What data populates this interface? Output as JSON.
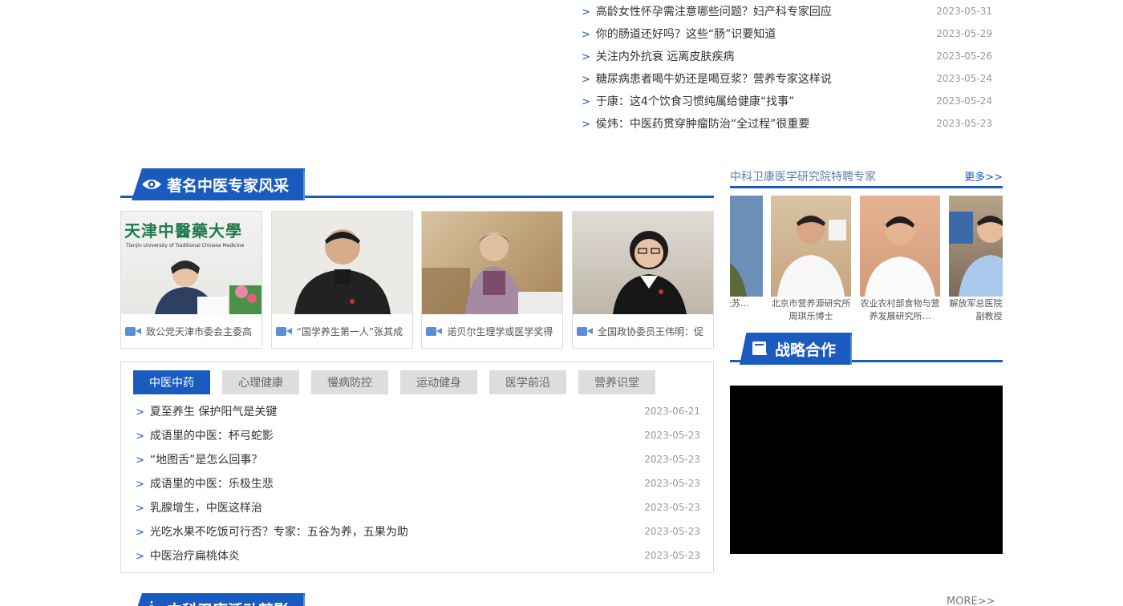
{
  "top_news": [
    {
      "title": "高龄女性怀孕需注意哪些问题？妇产科专家回应",
      "date": "2023-05-31"
    },
    {
      "title": "你的肠道还好吗？这些“肠”识要知道",
      "date": "2023-05-29"
    },
    {
      "title": "关注内外抗衰 远离皮肤疾病",
      "date": "2023-05-26"
    },
    {
      "title": "糖尿病患者喝牛奶还是喝豆浆？营养专家这样说",
      "date": "2023-05-24"
    },
    {
      "title": "于康：这4个饮食习惯纯属给健康“找事”",
      "date": "2023-05-24"
    },
    {
      "title": "侯炜：中医药贯穿肿瘤防治“全过程”很重要",
      "date": "2023-05-23"
    }
  ],
  "experts_section": {
    "title": "著名中医专家风采"
  },
  "experts": [
    {
      "caption": "致公党天津市委会主委高"
    },
    {
      "caption": "“国学养生第一人”张其成"
    },
    {
      "caption": "诺贝尔生理学或医学奖得"
    },
    {
      "caption": "全国政协委员王伟明：促"
    }
  ],
  "tju_sign": {
    "cn": "天津中醫藥大學",
    "en": "Tianjin University of Traditional Chinese Medicine"
  },
  "tabs": [
    "中医中药",
    "心理健康",
    "慢病防控",
    "运动健身",
    "医学前沿",
    "营养识堂"
  ],
  "tab_news": [
    {
      "title": "夏至养生 保护阳气是关键",
      "date": "2023-06-21"
    },
    {
      "title": "成语里的中医：杯弓蛇影",
      "date": "2023-05-23"
    },
    {
      "title": "“地图舌”是怎么回事？",
      "date": "2023-05-23"
    },
    {
      "title": "成语里的中医：乐极生悲",
      "date": "2023-05-23"
    },
    {
      "title": "乳腺增生，中医这样治",
      "date": "2023-05-23"
    },
    {
      "title": "光吃水果不吃饭可行否？专家：五谷为养，五果为助",
      "date": "2023-05-23"
    },
    {
      "title": "中医治疗扁桃体炎",
      "date": "2023-05-23"
    }
  ],
  "specialists": {
    "title": "中科卫康医学研究院特聘专家",
    "more": "更多>>",
    "items": [
      {
        "name": "放军总长苏…"
      },
      {
        "name": "北京市营养源研究所周琪乐博士"
      },
      {
        "name": "农业农村部食物与营养发展研究所…"
      },
      {
        "name": "解放军总医院后伊阳副教授"
      }
    ]
  },
  "strategy_section": {
    "title": "战略合作"
  },
  "bottom_section": {
    "title": "中科卫康活动剪影",
    "more": "MORE>>"
  },
  "colors": {
    "primary": "#1a5bbf",
    "tab_inactive": "#dddddd"
  }
}
